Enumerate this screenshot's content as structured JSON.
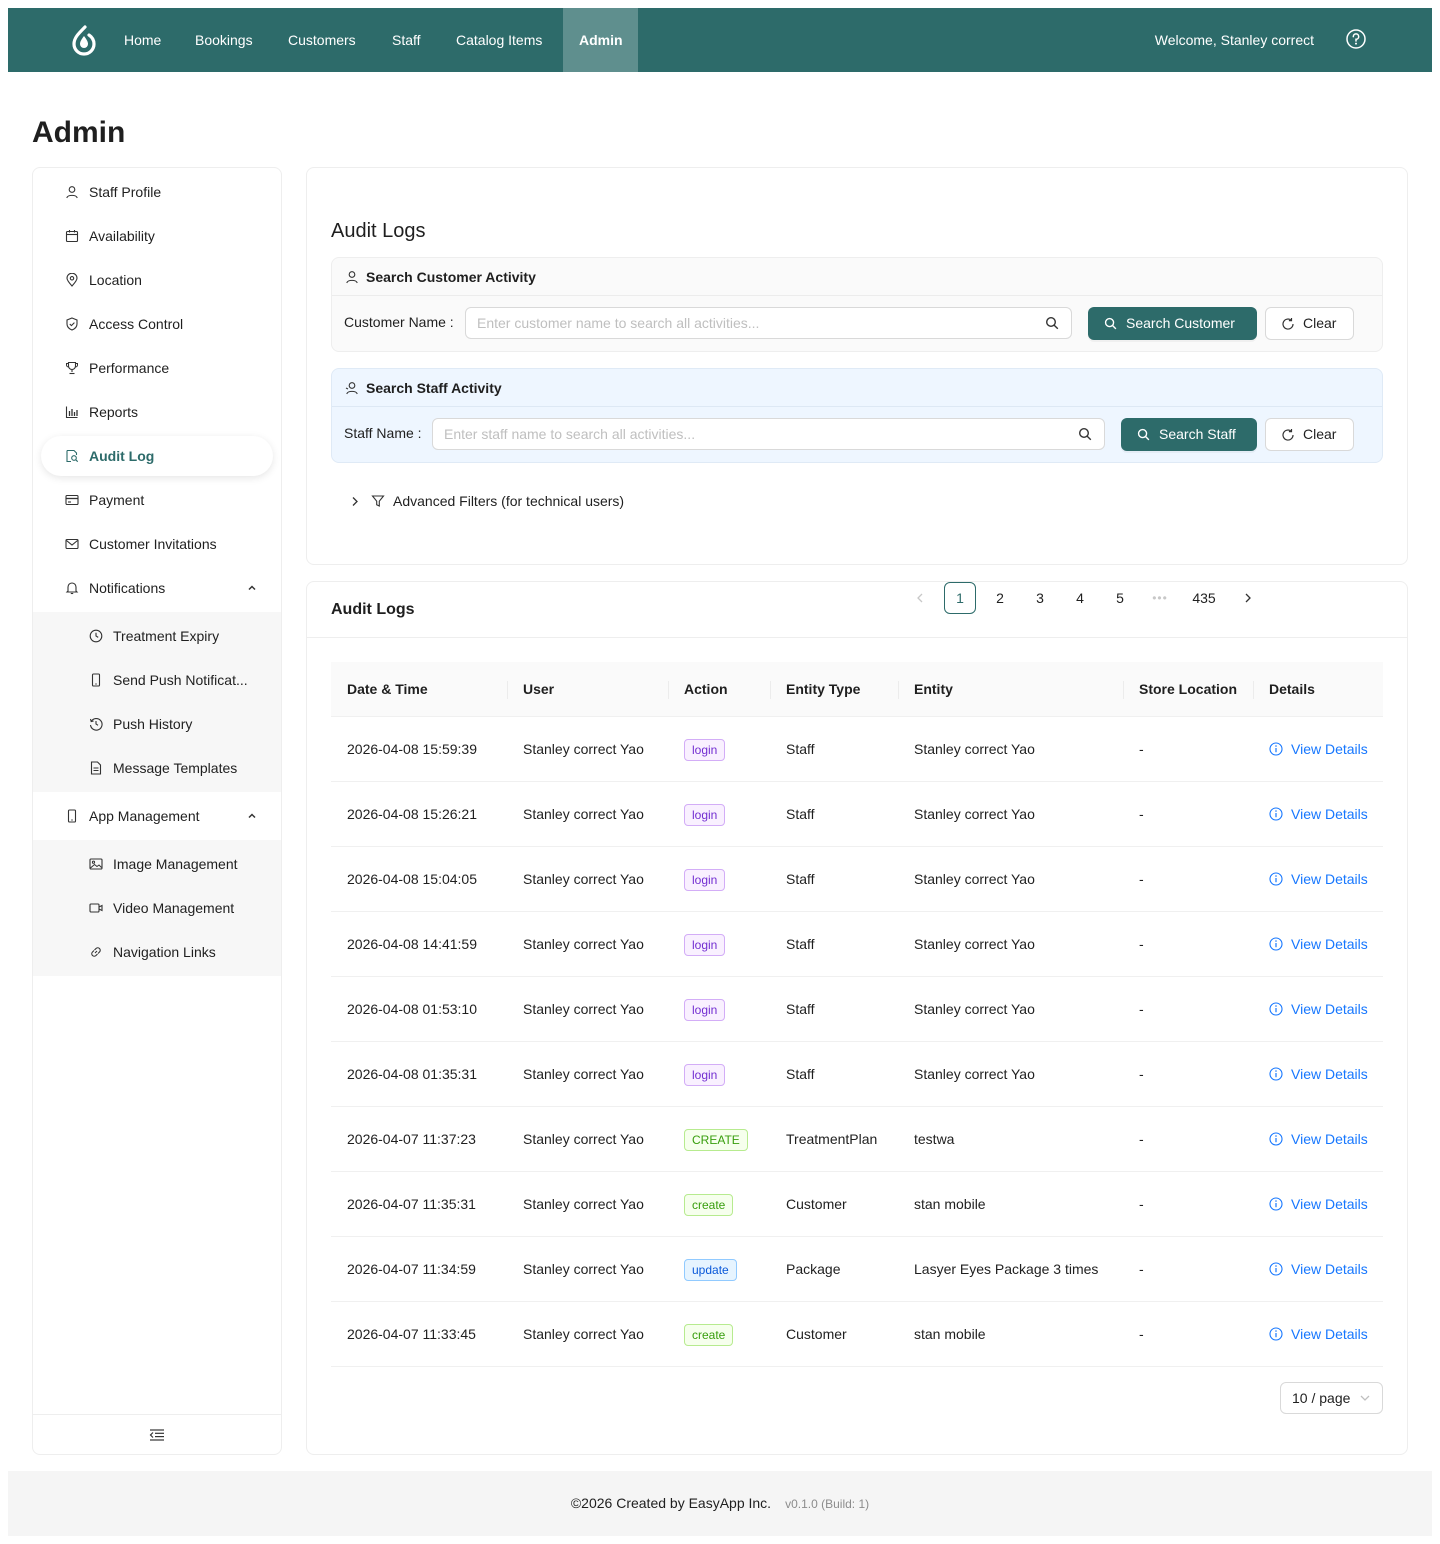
{
  "nav": {
    "items": [
      "Home",
      "Bookings",
      "Customers",
      "Staff",
      "Catalog Items",
      "Admin"
    ],
    "active": "Admin",
    "welcome": "Welcome, Stanley correct",
    "brand_color": "#2d6b6a"
  },
  "page_title": "Admin",
  "sidebar": {
    "items": [
      {
        "label": "Staff Profile",
        "icon": "user-icon"
      },
      {
        "label": "Availability",
        "icon": "calendar-icon"
      },
      {
        "label": "Location",
        "icon": "location-pin-icon"
      },
      {
        "label": "Access Control",
        "icon": "shield-icon"
      },
      {
        "label": "Performance",
        "icon": "trophy-icon"
      },
      {
        "label": "Reports",
        "icon": "bar-chart-icon"
      },
      {
        "label": "Audit Log",
        "icon": "file-search-icon",
        "active": true
      },
      {
        "label": "Payment",
        "icon": "credit-card-icon"
      },
      {
        "label": "Customer Invitations",
        "icon": "mail-icon"
      }
    ],
    "notifications": {
      "label": "Notifications",
      "icon": "bell-icon",
      "expanded": true,
      "children": [
        {
          "label": "Treatment Expiry",
          "icon": "clock-icon"
        },
        {
          "label": "Send Push Notificat...",
          "icon": "mobile-icon"
        },
        {
          "label": "Push History",
          "icon": "history-icon"
        },
        {
          "label": "Message Templates",
          "icon": "file-text-icon"
        }
      ]
    },
    "app_management": {
      "label": "App Management",
      "icon": "mobile-icon",
      "expanded": true,
      "children": [
        {
          "label": "Image Management",
          "icon": "image-icon"
        },
        {
          "label": "Video Management",
          "icon": "video-icon"
        },
        {
          "label": "Navigation Links",
          "icon": "link-icon"
        }
      ]
    }
  },
  "audit": {
    "title": "Audit Logs",
    "customer_search": {
      "heading": "Search Customer Activity",
      "label": "Customer Name",
      "placeholder": "Enter customer name to search all activities...",
      "search_button": "Search Customer",
      "clear_button": "Clear"
    },
    "staff_search": {
      "heading": "Search Staff Activity",
      "label": "Staff Name",
      "placeholder": "Enter staff name to search all activities...",
      "search_button": "Search Staff",
      "clear_button": "Clear"
    },
    "advanced_filters": "Advanced Filters (for technical users)"
  },
  "logs": {
    "title": "Audit Logs",
    "columns": [
      "Date & Time",
      "User",
      "Action",
      "Entity Type",
      "Entity",
      "Store Location",
      "Details"
    ],
    "rows": [
      {
        "datetime": "2026-04-08 15:59:39",
        "user": "Stanley correct Yao",
        "action": "login",
        "action_color": "purple",
        "entity_type": "Staff",
        "entity": "Stanley correct Yao",
        "store": "-",
        "details": "View Details"
      },
      {
        "datetime": "2026-04-08 15:26:21",
        "user": "Stanley correct Yao",
        "action": "login",
        "action_color": "purple",
        "entity_type": "Staff",
        "entity": "Stanley correct Yao",
        "store": "-",
        "details": "View Details"
      },
      {
        "datetime": "2026-04-08 15:04:05",
        "user": "Stanley correct Yao",
        "action": "login",
        "action_color": "purple",
        "entity_type": "Staff",
        "entity": "Stanley correct Yao",
        "store": "-",
        "details": "View Details"
      },
      {
        "datetime": "2026-04-08 14:41:59",
        "user": "Stanley correct Yao",
        "action": "login",
        "action_color": "purple",
        "entity_type": "Staff",
        "entity": "Stanley correct Yao",
        "store": "-",
        "details": "View Details"
      },
      {
        "datetime": "2026-04-08 01:53:10",
        "user": "Stanley correct Yao",
        "action": "login",
        "action_color": "purple",
        "entity_type": "Staff",
        "entity": "Stanley correct Yao",
        "store": "-",
        "details": "View Details"
      },
      {
        "datetime": "2026-04-08 01:35:31",
        "user": "Stanley correct Yao",
        "action": "login",
        "action_color": "purple",
        "entity_type": "Staff",
        "entity": "Stanley correct Yao",
        "store": "-",
        "details": "View Details"
      },
      {
        "datetime": "2026-04-07 11:37:23",
        "user": "Stanley correct Yao",
        "action": "CREATE",
        "action_color": "green",
        "entity_type": "TreatmentPlan",
        "entity": "testwa",
        "store": "-",
        "details": "View Details"
      },
      {
        "datetime": "2026-04-07 11:35:31",
        "user": "Stanley correct Yao",
        "action": "create",
        "action_color": "green",
        "entity_type": "Customer",
        "entity": "stan mobile",
        "store": "-",
        "details": "View Details"
      },
      {
        "datetime": "2026-04-07 11:34:59",
        "user": "Stanley correct Yao",
        "action": "update",
        "action_color": "blue",
        "entity_type": "Package",
        "entity": "Lasyer Eyes Package 3 times",
        "store": "-",
        "details": "View Details"
      },
      {
        "datetime": "2026-04-07 11:33:45",
        "user": "Stanley correct Yao",
        "action": "create",
        "action_color": "green",
        "entity_type": "Customer",
        "entity": "stan mobile",
        "store": "-",
        "details": "View Details"
      }
    ]
  },
  "pagination": {
    "pages": [
      "1",
      "2",
      "3",
      "4",
      "5"
    ],
    "current": "1",
    "ellipsis": "•••",
    "last": "435",
    "page_size": "10 / page"
  },
  "footer": {
    "copyright": "©2026 Created by EasyApp Inc.",
    "version": "v0.1.0 (Build: 1)"
  }
}
